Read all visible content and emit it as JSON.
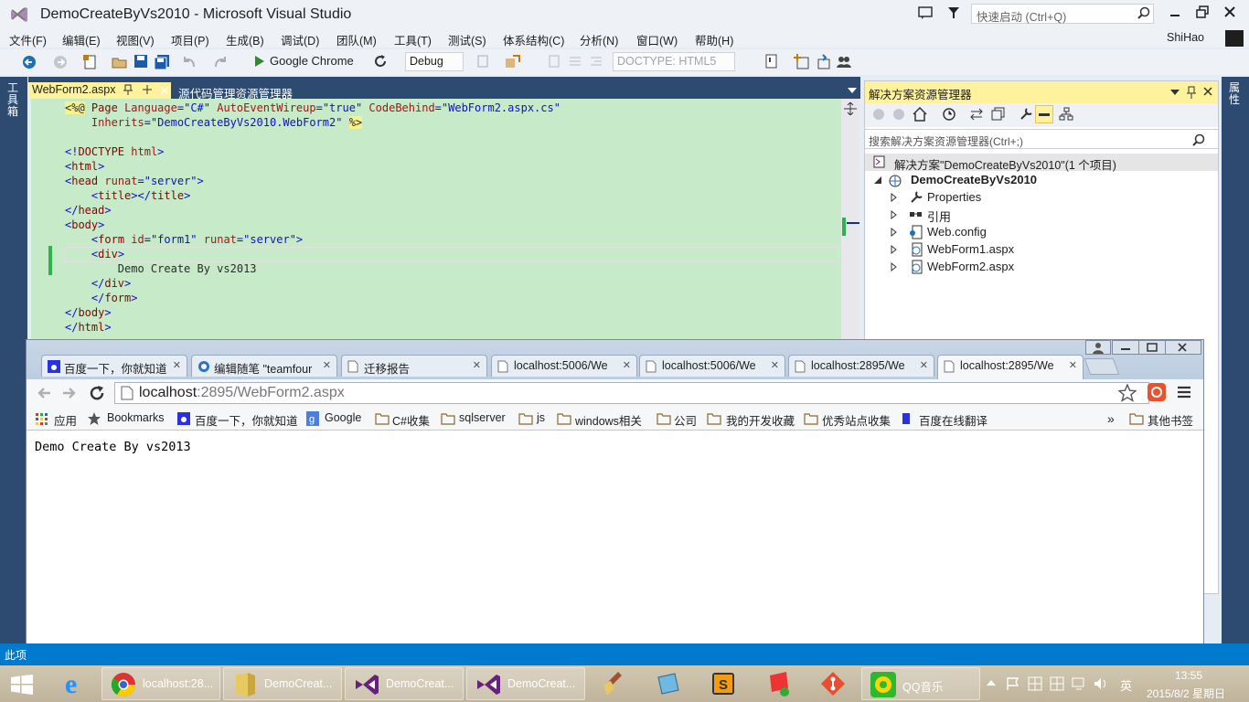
{
  "vs": {
    "title": "DemoCreateByVs2010 - Microsoft Visual Studio",
    "quick_launch_placeholder": "快速启动 (Ctrl+Q)",
    "user": "ShiHao",
    "menu": [
      "文件(F)",
      "编辑(E)",
      "视图(V)",
      "项目(P)",
      "生成(B)",
      "调试(D)",
      "团队(M)",
      "工具(T)",
      "测试(S)",
      "体系结构(C)",
      "分析(N)",
      "窗口(W)",
      "帮助(H)"
    ],
    "toolbar": {
      "browser": "Google Chrome",
      "config": "Debug",
      "doctype": "DOCTYPE: HTML5"
    },
    "left_strip_label": "工具箱",
    "right_strip_label": "属性",
    "status_text": "此项",
    "doc_tabs": [
      {
        "label": "WebForm2.aspx",
        "active": true
      },
      {
        "label": "源代码管理资源管理器",
        "active": false
      }
    ],
    "code_lines": [
      [
        "<%@ Page Language=\"C#\" AutoEventWireup=\"true\" CodeBehind=\"WebForm2.aspx.cs\""
      ],
      [
        "    Inherits=\"DemoCreateByVs2010.WebForm2\" %>"
      ],
      [
        ""
      ],
      [
        "<!DOCTYPE html>"
      ],
      [
        "<html>"
      ],
      [
        "<head runat=\"server\">"
      ],
      [
        "    <title></title>"
      ],
      [
        "</head>"
      ],
      [
        "<body>"
      ],
      [
        "    <form id=\"form1\" runat=\"server\">"
      ],
      [
        "    <div>"
      ],
      [
        "        Demo Create By vs2013"
      ],
      [
        "    </div>"
      ],
      [
        "    </form>"
      ],
      [
        "</body>"
      ],
      [
        "</html>"
      ]
    ],
    "solution_explorer": {
      "title": "解决方案资源管理器",
      "search_placeholder": "搜索解决方案资源管理器(Ctrl+;)",
      "solution": "解决方案\"DemoCreateByVs2010\"(1 个项目)",
      "project": "DemoCreateByVs2010",
      "items": [
        "Properties",
        "引用",
        "Web.config",
        "WebForm1.aspx",
        "WebForm2.aspx"
      ]
    }
  },
  "browser": {
    "tabs": [
      "百度一下，你就知道",
      "编辑随笔 \"teamfour",
      "迁移报告",
      "localhost:5006/We",
      "localhost:5006/We",
      "localhost:2895/We",
      "localhost:2895/We"
    ],
    "url_host": "localhost",
    "url_rest": ":2895/WebForm2.aspx",
    "bookmarks": [
      "应用",
      "Bookmarks",
      "百度一下，你就知道",
      "Google",
      "C#收集",
      "sqlserver",
      "js",
      "windows相关",
      "公司",
      "我的开发收藏",
      "优秀站点收集",
      "百度在线翻译"
    ],
    "other_bookmarks": "其他书签",
    "page_text": "Demo Create By vs2013"
  },
  "taskbar": {
    "items": [
      "localhost:28...",
      "DemoCreat...",
      "DemoCreat...",
      "DemoCreat...",
      "QQ音乐"
    ],
    "ime": "英",
    "time": "13:55",
    "date": "2015/8/2 星期日"
  }
}
